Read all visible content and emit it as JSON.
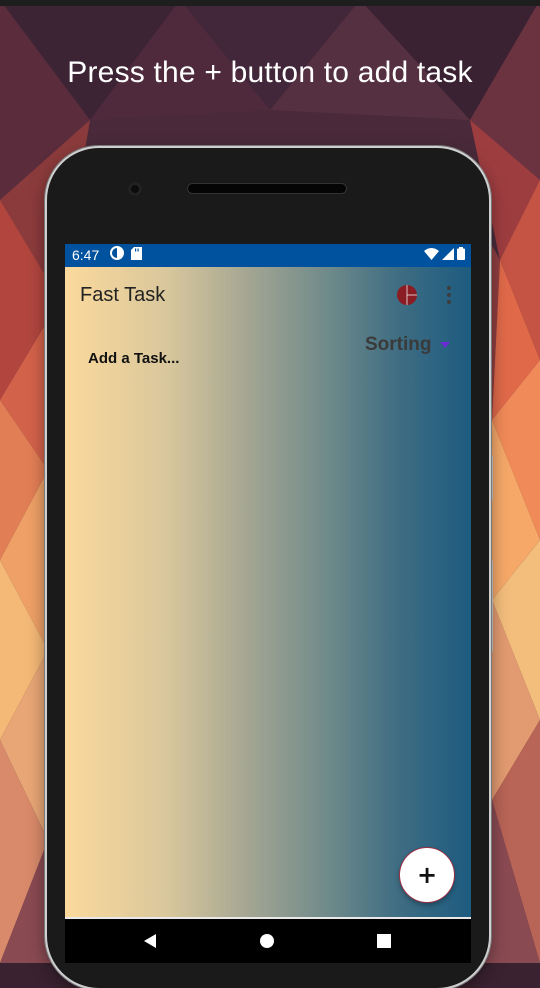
{
  "caption": "Press the + button to add task",
  "status_bar": {
    "time": "6:47",
    "left_icons": [
      "data-saver-icon",
      "sd-card-icon"
    ],
    "right_icons": [
      "wifi-icon",
      "cell-signal-icon",
      "battery-icon"
    ],
    "color": "#00529e"
  },
  "app": {
    "title": "Fast Task",
    "pie_chart_icon": "pie-chart-icon",
    "menu_icon": "overflow-menu-icon",
    "task_input_placeholder": "Add a Task...",
    "sorting_label": "Sorting",
    "fab_label": "+",
    "gradient": [
      "#fbd99c",
      "#a4a693",
      "#1d5b80"
    ]
  },
  "nav_bar": {
    "buttons": [
      "back-icon",
      "home-icon",
      "recents-icon"
    ]
  },
  "colors": {
    "accent_dropdown": "#6a2bd4",
    "pie_icon": "#8a1c24",
    "fab_border": "#9a3044"
  }
}
